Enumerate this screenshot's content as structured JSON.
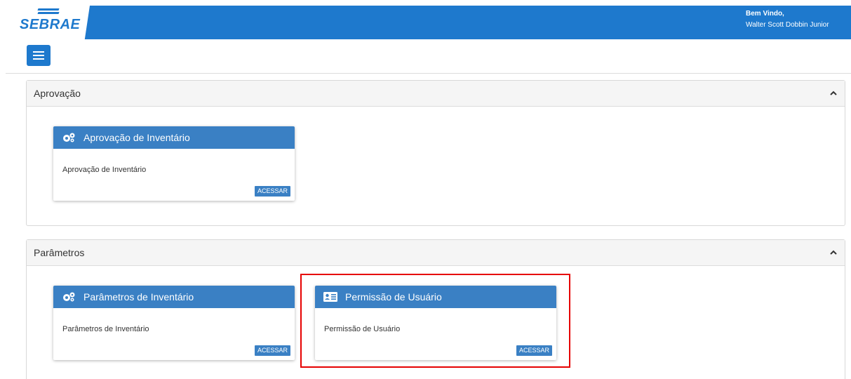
{
  "header": {
    "logo_text": "SEBRAE",
    "welcome_label": "Bem Vindo,",
    "user_name": "Walter Scott Dobbin Junior",
    "accent_color": "#1e79cd"
  },
  "toolbar": {
    "menu_icon": "hamburger-menu-icon"
  },
  "sections": [
    {
      "title": "Aprovação",
      "cards": [
        {
          "icon": "gears-icon",
          "title": "Aprovação de Inventário",
          "description": "Aprovação de Inventário",
          "button_label": "ACESSAR"
        }
      ]
    },
    {
      "title": "Parâmetros",
      "cards": [
        {
          "icon": "gears-icon",
          "title": "Parâmetros de Inventário",
          "description": "Parâmetros de Inventário",
          "button_label": "ACESSAR"
        },
        {
          "icon": "id-card-icon",
          "title": "Permissão de Usuário",
          "description": "Permissão de Usuário",
          "button_label": "ACESSAR"
        }
      ]
    }
  ],
  "highlight_color": "#e60000"
}
